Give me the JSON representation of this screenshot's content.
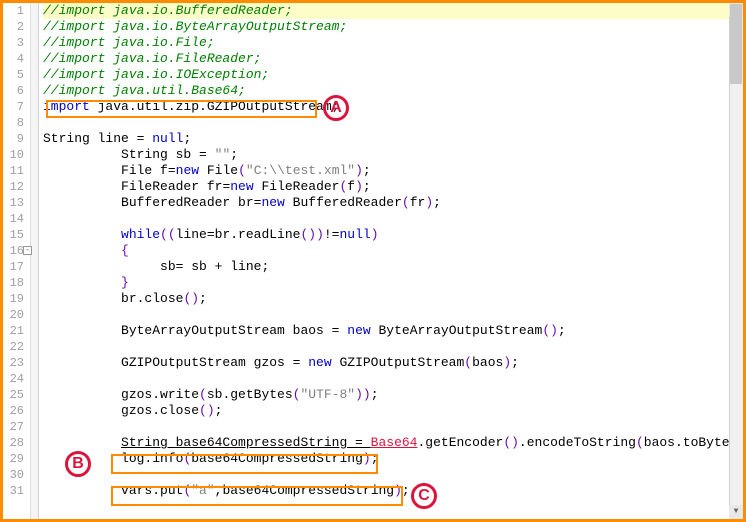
{
  "annotations": {
    "A": "A",
    "B": "B",
    "C": "C"
  },
  "fold": "-",
  "scroll": {
    "up": "▲",
    "down": "▼"
  },
  "lines": {
    "n1": "1",
    "l1": "//import java.io.BufferedReader;",
    "n2": "2",
    "l2": "//import java.io.ByteArrayOutputStream;",
    "n3": "3",
    "l3": "//import java.io.File;",
    "n4": "4",
    "l4": "//import java.io.FileReader;",
    "n5": "5",
    "l5": "//import java.io.IOException;",
    "n6": "6",
    "l6": "//import java.util.Base64;",
    "n7": "7",
    "l7_kw": "import",
    "l7_rest": " java.util.zip.GZIPOutputStream;",
    "n8": "8",
    "n9": "9",
    "l9_t": "String ",
    "l9_v": "line = ",
    "l9_kw": "null",
    "l9_e": ";",
    "n10": "10",
    "l10_pad": "          ",
    "l10_t": "String ",
    "l10_v": "sb = ",
    "l10_s": "\"\"",
    "l10_e": ";",
    "n11": "11",
    "l11_pad": "          ",
    "l11_t": "File ",
    "l11_v": "f=",
    "l11_kw": "new ",
    "l11_c": "File",
    "l11_p1": "(",
    "l11_s": "\"C:\\\\test.xml\"",
    "l11_p2": ")",
    "l11_e": ";",
    "n12": "12",
    "l12_pad": "          ",
    "l12_t": "FileReader ",
    "l12_v": "fr=",
    "l12_kw": "new ",
    "l12_c": "FileReader",
    "l12_p1": "(",
    "l12_a": "f",
    "l12_p2": ")",
    "l12_e": ";",
    "n13": "13",
    "l13_pad": "          ",
    "l13_t": "BufferedReader ",
    "l13_v": "br=",
    "l13_kw": "new ",
    "l13_c": "BufferedReader",
    "l13_p1": "(",
    "l13_a": "fr",
    "l13_p2": ")",
    "l13_e": ";",
    "n14": "14",
    "n15": "15",
    "l15_pad": "          ",
    "l15_kw": "while",
    "l15_p1": "((",
    "l15_v": "line=br.readLine",
    "l15_p2": "())",
    "l15_op": "!=",
    "l15_kw2": "null",
    "l15_p3": ")",
    "n16": "16",
    "l16_pad": "          ",
    "l16_b": "{",
    "n17": "17",
    "l17_pad": "               ",
    "l17_v": "sb= sb + line;",
    "n18": "18",
    "l18_pad": "          ",
    "l18_b": "}",
    "n19": "19",
    "l19_pad": "          ",
    "l19_v": "br.close",
    "l19_p": "()",
    "l19_e": ";",
    "n20": "20",
    "n21": "21",
    "l21_pad": "          ",
    "l21_t": "ByteArrayOutputStream ",
    "l21_v": "baos = ",
    "l21_kw": "new ",
    "l21_c": "ByteArrayOutputStream",
    "l21_p": "()",
    "l21_e": ";",
    "n22": "22",
    "n23": "23",
    "l23_pad": "          ",
    "l23_t": "GZIPOutputStream ",
    "l23_v": "gzos = ",
    "l23_kw": "new ",
    "l23_c": "GZIPOutputStream",
    "l23_p1": "(",
    "l23_a": "baos",
    "l23_p2": ")",
    "l23_e": ";",
    "n24": "24",
    "n25": "25",
    "l25_pad": "          ",
    "l25_v": "gzos.write",
    "l25_p1": "(",
    "l25_v2": "sb.getBytes",
    "l25_p2": "(",
    "l25_s": "\"UTF-8\"",
    "l25_p3": "))",
    "l25_e": ";",
    "n26": "26",
    "l26_pad": "          ",
    "l26_v": "gzos.close",
    "l26_p": "()",
    "l26_e": ";",
    "n27": "27",
    "n28": "28",
    "l28_pad": "          ",
    "l28_t": "String ",
    "l28_v": "base64CompressedString = ",
    "l28_err": "Base64",
    "l28_v2": ".getEncoder",
    "l28_p1": "()",
    "l28_v3": ".encodeToString",
    "l28_p2": "(",
    "l28_v4": "baos.toByteArray",
    "l28_p3": "())",
    "l28_e": ";",
    "n29": "29",
    "l29_pad": "          ",
    "l29_v": "log.info",
    "l29_p1": "(",
    "l29_a": "base64CompressedString",
    "l29_p2": ")",
    "l29_e": ";",
    "n30": "30",
    "n31": "31",
    "l31_pad": "          ",
    "l31_v": "vars.put",
    "l31_p1": "(",
    "l31_s": "\"a\"",
    "l31_c": ",",
    "l31_a": "base64CompressedString",
    "l31_p2": ")",
    "l31_e": ";"
  }
}
